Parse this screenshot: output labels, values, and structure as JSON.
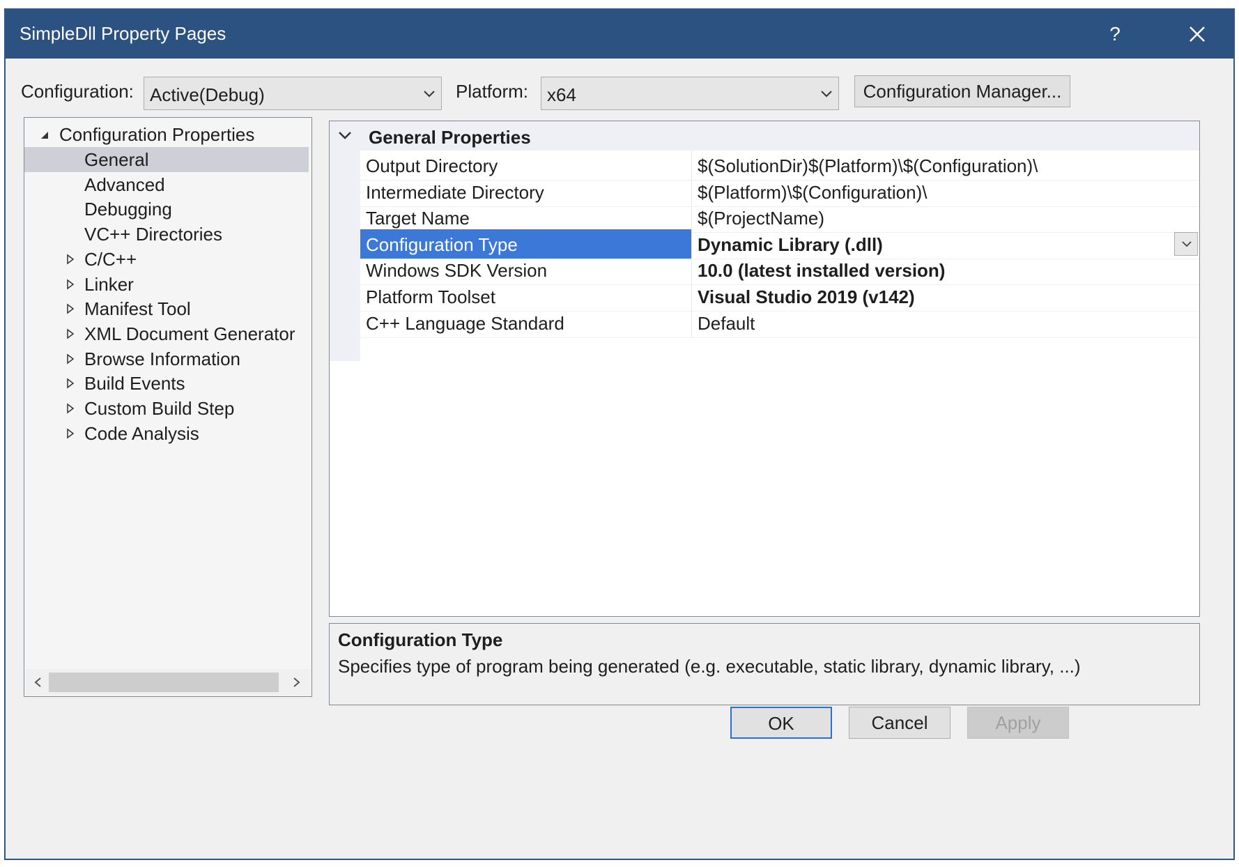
{
  "window": {
    "title": "SimpleDll Property Pages",
    "help": "?"
  },
  "toolbar": {
    "configuration_label": "Configuration:",
    "configuration_value": "Active(Debug)",
    "platform_label": "Platform:",
    "platform_value": "x64",
    "config_manager": "Configuration Manager..."
  },
  "tree": {
    "root": "Configuration Properties",
    "items": [
      {
        "label": "General",
        "selected": true,
        "expandable": false
      },
      {
        "label": "Advanced",
        "expandable": false
      },
      {
        "label": "Debugging",
        "expandable": false
      },
      {
        "label": "VC++ Directories",
        "expandable": false
      },
      {
        "label": "C/C++",
        "expandable": true
      },
      {
        "label": "Linker",
        "expandable": true
      },
      {
        "label": "Manifest Tool",
        "expandable": true
      },
      {
        "label": "XML Document Generator",
        "expandable": true
      },
      {
        "label": "Browse Information",
        "expandable": true
      },
      {
        "label": "Build Events",
        "expandable": true
      },
      {
        "label": "Custom Build Step",
        "expandable": true
      },
      {
        "label": "Code Analysis",
        "expandable": true
      }
    ]
  },
  "grid": {
    "category": "General Properties",
    "rows": [
      {
        "name": "Output Directory",
        "value": "$(SolutionDir)$(Platform)\\$(Configuration)\\",
        "bold": false
      },
      {
        "name": "Intermediate Directory",
        "value": "$(Platform)\\$(Configuration)\\",
        "bold": false
      },
      {
        "name": "Target Name",
        "value": "$(ProjectName)",
        "bold": false
      },
      {
        "name": "Configuration Type",
        "value": "Dynamic Library (.dll)",
        "bold": true,
        "selected": true
      },
      {
        "name": "Windows SDK Version",
        "value": "10.0 (latest installed version)",
        "bold": true
      },
      {
        "name": "Platform Toolset",
        "value": "Visual Studio 2019 (v142)",
        "bold": true
      },
      {
        "name": "C++ Language Standard",
        "value": "Default",
        "bold": false
      }
    ]
  },
  "description": {
    "title": "Configuration Type",
    "text": "Specifies type of program being generated (e.g. executable, static library, dynamic library, ...)"
  },
  "buttons": {
    "ok": "OK",
    "cancel": "Cancel",
    "apply": "Apply"
  },
  "colors": {
    "titlebar": "#2b5280",
    "selection": "#3c78d8",
    "tree_selection": "#cfcfd8"
  }
}
